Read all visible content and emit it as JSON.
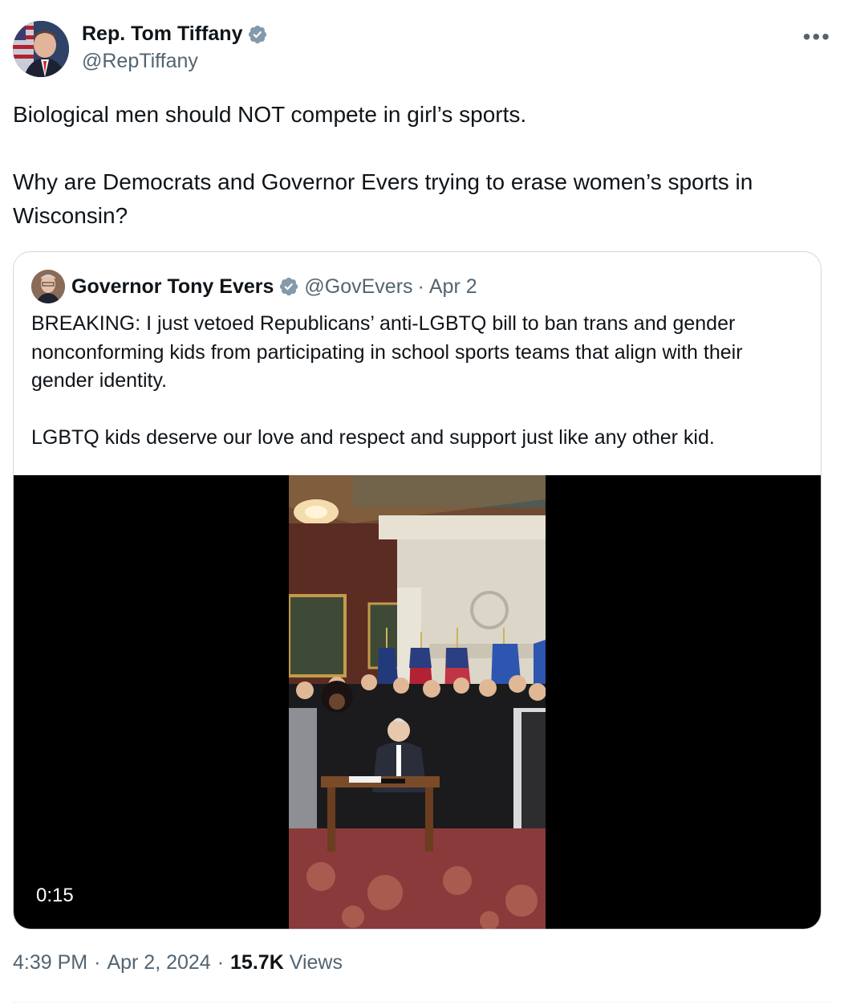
{
  "author": {
    "name": "Rep. Tom Tiffany",
    "handle": "@RepTiffany",
    "verified_color": "#829aab"
  },
  "tweet": {
    "paragraph1": "Biological men should NOT compete in girl’s sports.",
    "paragraph2": "Why are Democrats and Governor Evers trying to erase women’s sports in Wisconsin?"
  },
  "quoted": {
    "name": "Governor Tony Evers",
    "handle": "@GovEvers",
    "separator": "·",
    "date": "Apr 2",
    "paragraph1": "BREAKING: I just vetoed Republicans’ anti-LGBTQ bill to ban trans and gender nonconforming kids from participating in school sports teams that align with their gender identity.",
    "paragraph2": "LGBTQ kids deserve our love and respect and support just like any other kid.",
    "video": {
      "duration": "0:15"
    }
  },
  "meta": {
    "time": "4:39 PM",
    "sep1": "·",
    "date": "Apr 2, 2024",
    "sep2": "·",
    "views_count": "15.7K",
    "views_label": "Views"
  },
  "more_icon": "more-horizontal-icon"
}
